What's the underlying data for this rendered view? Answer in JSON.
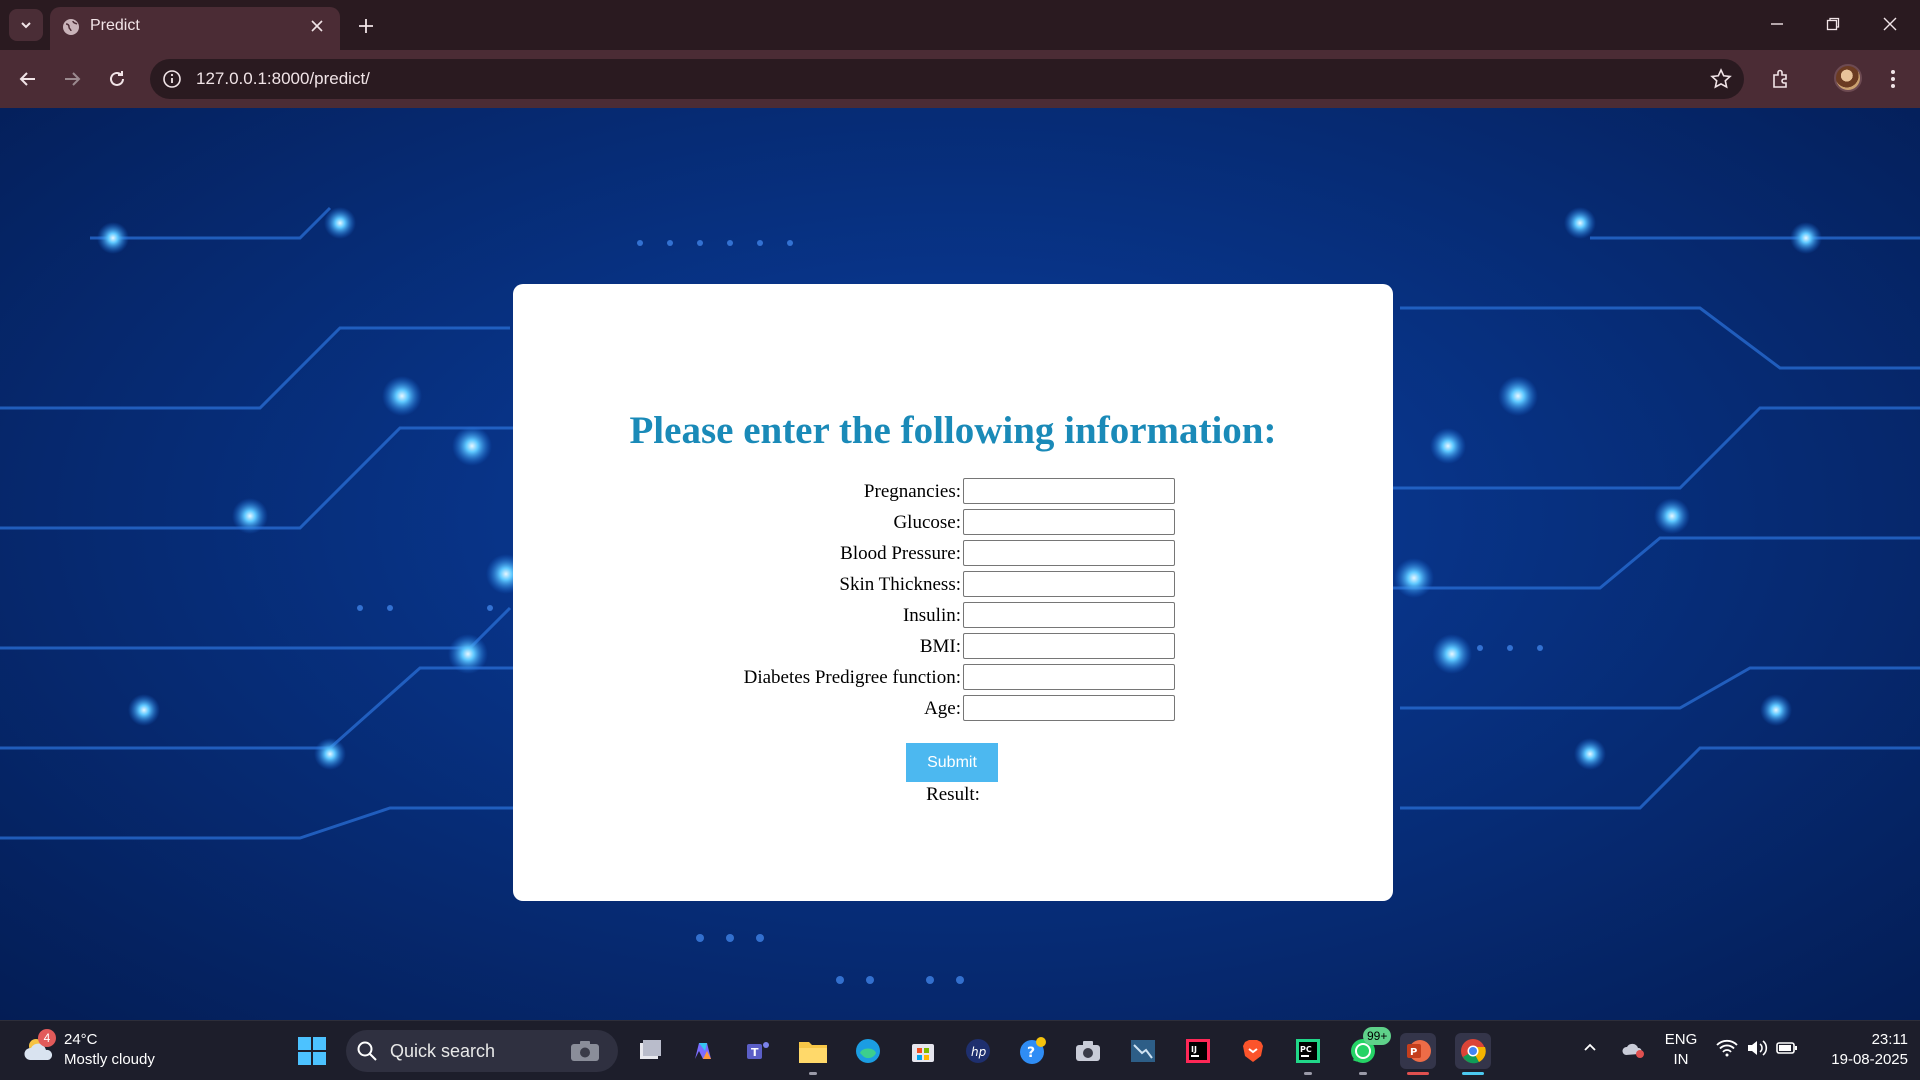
{
  "browser": {
    "tab": {
      "title": "Predict"
    },
    "address_bar": {
      "url": "127.0.0.1:8000/predict/"
    }
  },
  "form": {
    "title": "Please enter the following information:",
    "fields": [
      {
        "label": "Pregnancies:",
        "value": ""
      },
      {
        "label": "Glucose:",
        "value": ""
      },
      {
        "label": "Blood Pressure:",
        "value": ""
      },
      {
        "label": "Skin Thickness:",
        "value": ""
      },
      {
        "label": "Insulin:",
        "value": ""
      },
      {
        "label": "BMI:",
        "value": ""
      },
      {
        "label": "Diabetes Predigree function:",
        "value": ""
      },
      {
        "label": "Age:",
        "value": ""
      }
    ],
    "submit_label": "Submit",
    "result_label": "Result:"
  },
  "colors": {
    "title": "#1a8ab8",
    "submit_bg": "#4cb8f0",
    "page_bg": "#0b2f7a",
    "chrome_bg": "#4b2c35"
  },
  "taskbar": {
    "weather": {
      "badge": "4",
      "temperature": "24°C",
      "description": "Mostly cloudy"
    },
    "search": {
      "placeholder": "Quick search"
    },
    "apps": [
      {
        "name": "task-view-icon"
      },
      {
        "name": "copilot-icon"
      },
      {
        "name": "teams-icon"
      },
      {
        "name": "file-explorer-icon"
      },
      {
        "name": "edge-icon"
      },
      {
        "name": "microsoft-store-icon"
      },
      {
        "name": "hp-icon"
      },
      {
        "name": "help-icon"
      },
      {
        "name": "camera-icon"
      },
      {
        "name": "mysql-workbench-icon"
      },
      {
        "name": "intellij-icon"
      },
      {
        "name": "brave-icon"
      },
      {
        "name": "pycharm-icon"
      },
      {
        "name": "whatsapp-icon",
        "badge": "99+"
      },
      {
        "name": "powerpoint-icon"
      },
      {
        "name": "chrome-icon"
      }
    ],
    "tray": {
      "language_top": "ENG",
      "language_bottom": "IN",
      "time": "23:11",
      "date": "19-08-2025"
    }
  }
}
